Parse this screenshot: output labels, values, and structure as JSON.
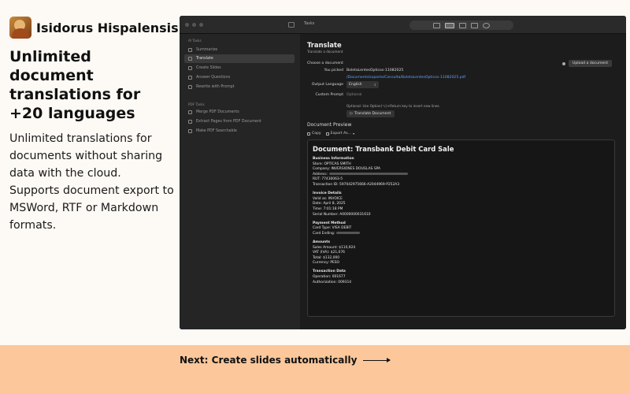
{
  "app": {
    "name": "Isidorus Hispalensis",
    "logo_icon": "saint-portrait-icon"
  },
  "marketing": {
    "headline": "Unlimited document translations for +20 languages",
    "description": [
      "Unlimited translations for documents without sharing data with the cloud.",
      "Supports document export to MSWord, RTF or Markdown formats."
    ]
  },
  "footer": {
    "next_label": "Next: Create slides automatically"
  },
  "window": {
    "title": "Tasks",
    "toolbar_icons": [
      "folder-icon",
      "layout-icon",
      "chat-icon",
      "grid-icon",
      "history-icon"
    ],
    "sidebar": {
      "group1_label": "AI Tasks",
      "group1_items": [
        {
          "label": "Summarize",
          "icon": "summarize-icon"
        },
        {
          "label": "Translate",
          "icon": "translate-icon",
          "selected": true
        },
        {
          "label": "Create Slides",
          "icon": "slides-icon"
        },
        {
          "label": "Answer Questions",
          "icon": "question-icon"
        },
        {
          "label": "Rewrite with Prompt",
          "icon": "rewrite-icon"
        }
      ],
      "group2_label": "PDF Tasks",
      "group2_items": [
        {
          "label": "Merge PDF Documents",
          "icon": "merge-icon"
        },
        {
          "label": "Extract Pages from PDF Document",
          "icon": "extract-icon"
        },
        {
          "label": "Make PDF Searchable",
          "icon": "search-icon"
        }
      ]
    },
    "main": {
      "title": "Translate",
      "subtitle": "Translate a document",
      "choose_label": "Choose a document",
      "upload_label": "Upload a document",
      "you_picked_label": "You picked",
      "picked_file": "BoletaLentesOpticos-11082025",
      "picked_path": "/Documents/soporte/Consulta/BoletaLentesOpticos-11082025.pdf",
      "output_language_label": "Output Language",
      "output_language_value": "English",
      "custom_prompt_label": "Custom Prompt",
      "custom_prompt_placeholder": "Optional",
      "hint": "Optional: Use Option(⌥)+Return key to insert new lines.",
      "translate_button": "Translate Document",
      "preview_title": "Document Preview",
      "copy_label": "Copy",
      "export_label": "Export As..."
    },
    "document": {
      "title": "Document: Transbank Debit Card Sale",
      "lines": [
        {
          "text": "Business Information",
          "head": true
        },
        {
          "text": "Store: OPTICAS SMITH"
        },
        {
          "text": "Company: INVERSIONES DOUGLAS SPA"
        },
        {
          "text": "Address:",
          "blur": 100
        },
        {
          "text": "RUT: 77430063-5"
        },
        {
          "text": "Transaction ID: 597042975666-A2044969-P252A3"
        },
        {
          "text": "Invoice Details",
          "head": true
        },
        {
          "text": "Valid as: INVOICE"
        },
        {
          "text": "Date: April 8, 2025"
        },
        {
          "text": "Time: 7:01:18 PM"
        },
        {
          "text": "Serial Number: A0000000031610"
        },
        {
          "text": "Payment Method",
          "head": true
        },
        {
          "text": "Card Type: VISA DEBIT"
        },
        {
          "text": "Card Ending:",
          "blur": 30
        },
        {
          "text": "Amounts",
          "head": true
        },
        {
          "text": "Sales Amount: $110,924"
        },
        {
          "text": "VAT (IVA): $21,076"
        },
        {
          "text": "Total: $132,000"
        },
        {
          "text": "Currency: PESO"
        },
        {
          "text": "Transaction Data",
          "head": true
        },
        {
          "text": "Operation: 001677"
        },
        {
          "text": "Authorization: 009314"
        }
      ]
    }
  }
}
